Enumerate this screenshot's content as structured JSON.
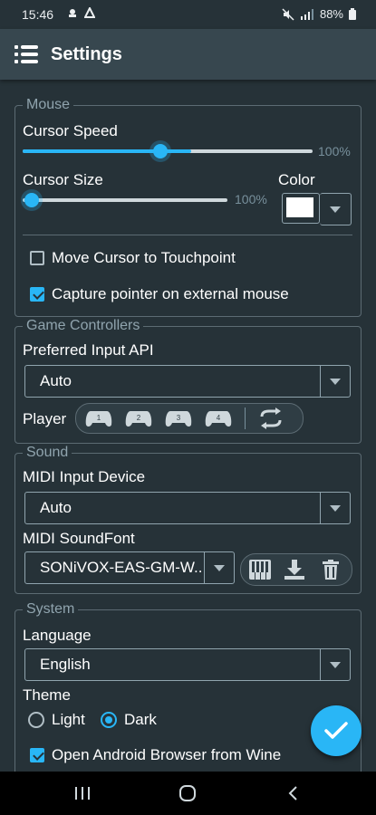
{
  "status": {
    "time": "15:46",
    "battery": "88%"
  },
  "appbar": {
    "title": "Settings"
  },
  "mouse": {
    "legend": "Mouse",
    "cursor_speed_label": "Cursor Speed",
    "cursor_speed_value": "100%",
    "cursor_speed_fraction": 0.58,
    "cursor_size_label": "Cursor Size",
    "cursor_size_value": "100%",
    "cursor_size_fraction": 0.0,
    "color_label": "Color",
    "cursor_color": "#ffffff",
    "move_cursor_label": "Move Cursor to Touchpoint",
    "move_cursor_checked": false,
    "capture_pointer_label": "Capture pointer on external mouse",
    "capture_pointer_checked": true
  },
  "controllers": {
    "legend": "Game Controllers",
    "input_api_label": "Preferred Input API",
    "input_api_value": "Auto",
    "player_label": "Player",
    "players": [
      "1",
      "2",
      "3",
      "4"
    ]
  },
  "sound": {
    "legend": "Sound",
    "midi_input_label": "MIDI Input Device",
    "midi_input_value": "Auto",
    "soundfont_label": "MIDI SoundFont",
    "soundfont_value": "SONiVOX-EAS-GM-W.."
  },
  "system": {
    "legend": "System",
    "language_label": "Language",
    "language_value": "English",
    "theme_label": "Theme",
    "theme_light": "Light",
    "theme_dark": "Dark",
    "theme_selected": "Dark",
    "open_browser_label": "Open Android Browser from Wine",
    "open_browser_checked": true
  },
  "colors": {
    "accent": "#29b6f6",
    "background": "#263238",
    "appbar": "#37474f"
  }
}
